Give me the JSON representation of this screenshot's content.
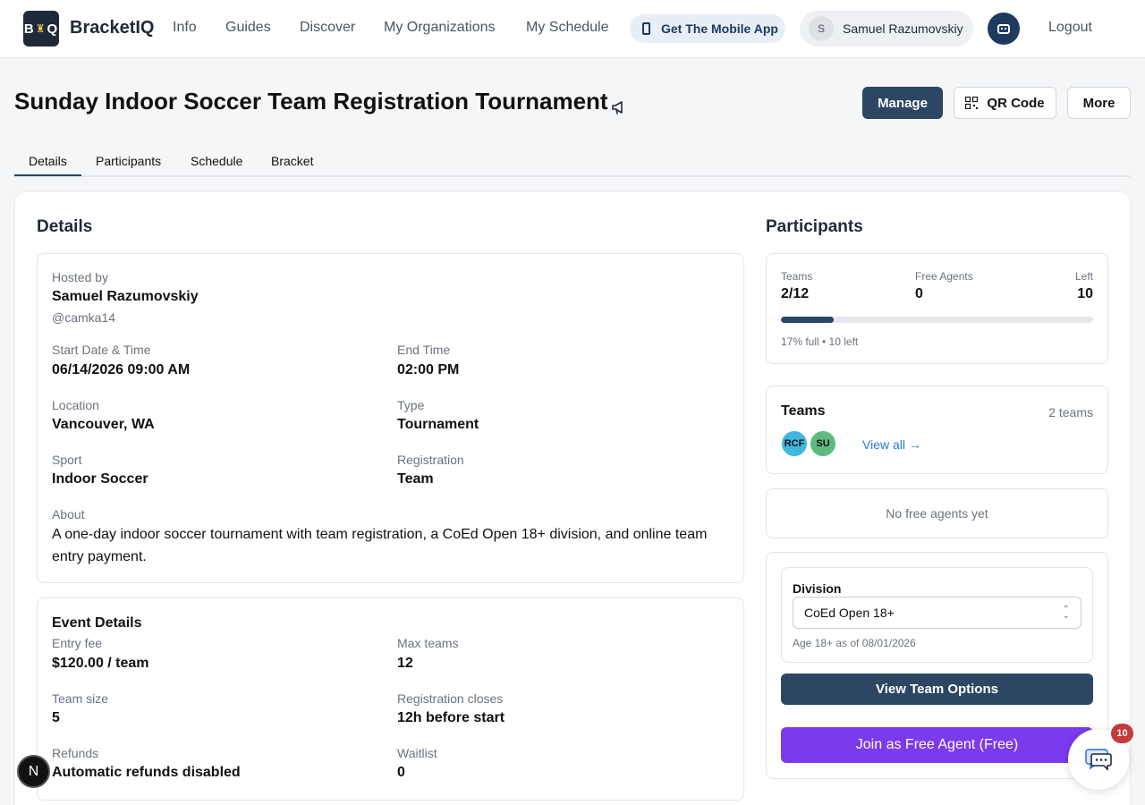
{
  "nav": {
    "logo_left": "B",
    "logo_right": "Q",
    "brand": "BracketIQ",
    "links": [
      "Info",
      "Guides",
      "Discover",
      "My Organizations",
      "My Schedule"
    ],
    "mobile_app": "Get The Mobile App",
    "user_initial": "S",
    "user_name": "Samuel Razumovskiy",
    "logout": "Logout"
  },
  "header": {
    "title": "Sunday Indoor Soccer Team Registration Tournament",
    "manage": "Manage",
    "qr_code": "QR Code",
    "more": "More"
  },
  "tabs": [
    "Details",
    "Participants",
    "Schedule",
    "Bracket"
  ],
  "details": {
    "heading": "Details",
    "hosted_by_label": "Hosted by",
    "host_name": "Samuel Razumovskiy",
    "host_handle": "@camka14",
    "start_label": "Start Date & Time",
    "start_value": "06/14/2026 09:00 AM",
    "end_label": "End Time",
    "end_value": "02:00 PM",
    "location_label": "Location",
    "location_value": "Vancouver, WA",
    "type_label": "Type",
    "type_value": "Tournament",
    "sport_label": "Sport",
    "sport_value": "Indoor Soccer",
    "registration_label": "Registration",
    "registration_value": "Team",
    "about_label": "About",
    "about_value": "A one-day indoor soccer tournament with team registration, a CoEd Open 18+ division, and online team entry payment."
  },
  "event_details": {
    "heading": "Event Details",
    "entry_fee_label": "Entry fee",
    "entry_fee_value": "$120.00 / team",
    "max_teams_label": "Max teams",
    "max_teams_value": "12",
    "team_size_label": "Team size",
    "team_size_value": "5",
    "reg_closes_label": "Registration closes",
    "reg_closes_value": "12h before start",
    "refunds_label": "Refunds",
    "refunds_value": "Automatic refunds disabled",
    "waitlist_label": "Waitlist",
    "waitlist_value": "0"
  },
  "participants": {
    "heading": "Participants",
    "teams_label": "Teams",
    "teams_value": "2/12",
    "free_agents_label": "Free Agents",
    "free_agents_value": "0",
    "left_label": "Left",
    "left_value": "10",
    "fill_fraction": 0.17,
    "fill_text": "17% full • 10 left"
  },
  "teams_card": {
    "heading": "Teams",
    "count": "2 teams",
    "chips": [
      {
        "label": "RCF",
        "color": "#3fb8e0"
      },
      {
        "label": "SU",
        "color": "#5dbb7f"
      }
    ],
    "view_all": "View all →"
  },
  "free_agents_card": {
    "empty_text": "No free agents yet"
  },
  "division": {
    "label": "Division",
    "selected": "CoEd Open 18+",
    "note": "Age 18+ as of 08/01/2026",
    "view_team_options": "View Team Options",
    "join_free_agent": "Join as Free Agent (Free)"
  },
  "floating": {
    "n_badge": "N",
    "chat_count": "10"
  },
  "colors": {
    "primary": "#2c4664",
    "purple": "#7c3aed",
    "link": "#2a7ad6",
    "badge_red": "#c53a3a"
  }
}
